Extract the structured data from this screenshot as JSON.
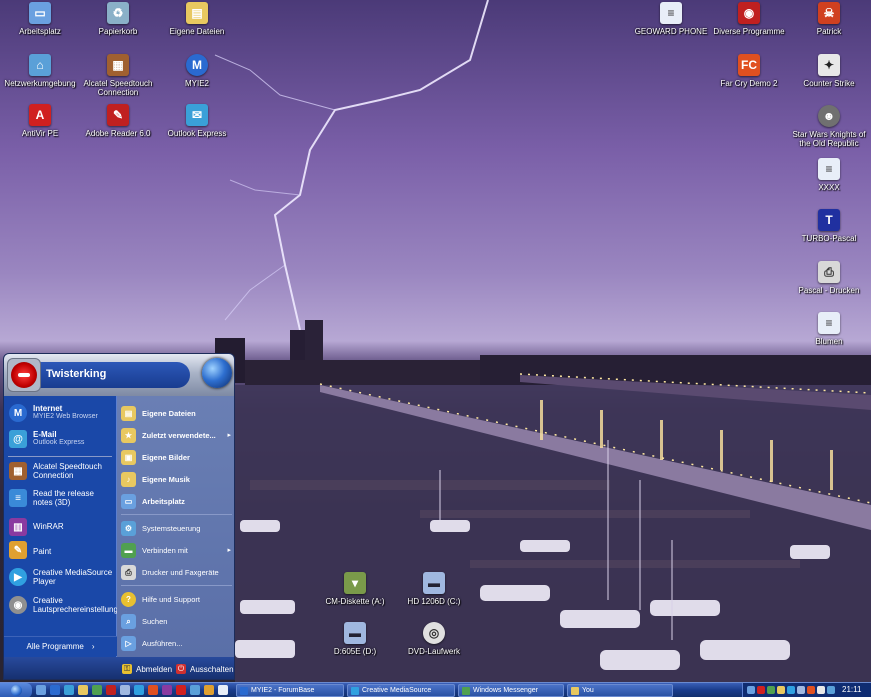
{
  "desktop": {
    "icons": [
      {
        "label": "Arbeitsplatz",
        "icon": "computer-icon",
        "color": "#6aa0e0"
      },
      {
        "label": "Papierkorb",
        "icon": "recycle-bin-icon",
        "color": "#8ab0c8"
      },
      {
        "label": "Eigene Dateien",
        "icon": "folder-icon",
        "color": "#e8c860"
      },
      {
        "label": "Netzwerkumgebung",
        "icon": "network-icon",
        "color": "#5aa0d8"
      },
      {
        "label": "Alcatel Speedtouch Connection",
        "icon": "modem-icon",
        "color": "#a06030"
      },
      {
        "label": "MYIE2",
        "icon": "browser-icon",
        "color": "#2a6ad0"
      },
      {
        "label": "AntiVir PE",
        "icon": "antivir-icon",
        "color": "#d02020"
      },
      {
        "label": "Adobe Reader 6.0",
        "icon": "pdf-icon",
        "color": "#c02020"
      },
      {
        "label": "Outlook Express",
        "icon": "mail-icon",
        "color": "#3aa0d8"
      },
      {
        "label": "GEOWARD PHONE",
        "icon": "document-icon",
        "color": "#e8eef8"
      },
      {
        "label": "Diverse Programme",
        "icon": "program-icon",
        "color": "#c02020"
      },
      {
        "label": "Patrick",
        "icon": "user-folder-icon",
        "color": "#d04020"
      },
      {
        "label": "Far Cry Demo 2",
        "icon": "farcry-icon",
        "color": "#e05020"
      },
      {
        "label": "Counter Strike",
        "icon": "counter-strike-icon",
        "color": "#e8e8e8"
      },
      {
        "label": "Star Wars Knights of the Old Republic",
        "icon": "game-icon",
        "color": "#707070"
      },
      {
        "label": "XXXX",
        "icon": "text-file-icon",
        "color": "#e8eef8"
      },
      {
        "label": "TURBO-Pascal",
        "icon": "turbo-pascal-icon",
        "color": "#2030a0"
      },
      {
        "label": "Pascal - Drucken",
        "icon": "printer-icon",
        "color": "#d8d8d8"
      },
      {
        "label": "Blumen",
        "icon": "text-file-icon",
        "color": "#e8eef8"
      },
      {
        "label": "CM-Diskette (A:)",
        "icon": "floppy-icon",
        "color": "#7a9a4a"
      },
      {
        "label": "HD 1206D (C:)",
        "icon": "hard-drive-icon",
        "color": "#a0b8e0"
      },
      {
        "label": "D:605E (D:)",
        "icon": "drive-icon",
        "color": "#a0b8e0"
      },
      {
        "label": "DVD-Laufwerk",
        "icon": "dvd-icon",
        "color": "#e0e0e0"
      }
    ]
  },
  "start_menu": {
    "username": "Twisterking",
    "left_items": [
      {
        "title": "Internet",
        "subtitle": "MYIE2 Web Browser",
        "icon": "browser-icon",
        "color": "#2a6ad0",
        "bold": true
      },
      {
        "title": "E-Mail",
        "subtitle": "Outlook Express",
        "icon": "mail-icon",
        "color": "#3aa0d8",
        "bold": true
      },
      {
        "title": "Alcatel Speedtouch Connection",
        "subtitle": "",
        "icon": "modem-icon",
        "color": "#a06030",
        "bold": false
      },
      {
        "title": "Read the release notes (3D)",
        "subtitle": "",
        "icon": "notes-icon",
        "color": "#3a8ad8",
        "bold": false
      },
      {
        "title": "WinRAR",
        "subtitle": "",
        "icon": "winrar-icon",
        "color": "#8a3aa0",
        "bold": false
      },
      {
        "title": "Paint",
        "subtitle": "",
        "icon": "paint-icon",
        "color": "#e0a030",
        "bold": false
      },
      {
        "title": "Creative MediaSource Player",
        "subtitle": "",
        "icon": "media-player-icon",
        "color": "#30a0e0",
        "bold": false
      },
      {
        "title": "Creative Lautsprechereinstellung",
        "subtitle": "",
        "icon": "speaker-icon",
        "color": "#909090",
        "bold": false
      }
    ],
    "all_programs": "Alle Programme",
    "right_items": [
      {
        "label": "Eigene Dateien",
        "icon": "folder-icon",
        "color": "#e8c860",
        "bold": true,
        "arrow": false
      },
      {
        "label": "Zuletzt verwendete...",
        "icon": "recent-icon",
        "color": "#e8c860",
        "bold": true,
        "arrow": true
      },
      {
        "label": "Eigene Bilder",
        "icon": "pictures-icon",
        "color": "#e8c860",
        "bold": true,
        "arrow": false
      },
      {
        "label": "Eigene Musik",
        "icon": "music-icon",
        "color": "#e8c860",
        "bold": true,
        "arrow": false
      },
      {
        "label": "Arbeitsplatz",
        "icon": "computer-icon",
        "color": "#6aa0e0",
        "bold": true,
        "arrow": false
      },
      {
        "label": "Systemsteuerung",
        "icon": "control-panel-icon",
        "color": "#5aa0d8",
        "bold": false,
        "arrow": false
      },
      {
        "label": "Verbinden mit",
        "icon": "connect-icon",
        "color": "#50a050",
        "bold": false,
        "arrow": true
      },
      {
        "label": "Drucker und Faxgeräte",
        "icon": "printer-icon",
        "color": "#d8d8d8",
        "bold": false,
        "arrow": false
      },
      {
        "label": "Hilfe und Support",
        "icon": "help-icon",
        "color": "#e8c030",
        "bold": false,
        "arrow": false
      },
      {
        "label": "Suchen",
        "icon": "search-icon",
        "color": "#6aa0e0",
        "bold": false,
        "arrow": false
      },
      {
        "label": "Ausführen...",
        "icon": "run-icon",
        "color": "#6aa0e0",
        "bold": false,
        "arrow": false
      }
    ],
    "logoff": "Abmelden",
    "shutdown": "Ausschalten"
  },
  "taskbar": {
    "tasks": [
      {
        "label": "MYIE2 - ForumBase",
        "color": "#2a6ad0"
      },
      {
        "label": "Creative MediaSource",
        "color": "#30a0e0"
      },
      {
        "label": "Windows Messenger",
        "color": "#50a050"
      },
      {
        "label": "You",
        "color": "#e8c860"
      }
    ],
    "clock": "21:11"
  },
  "colors": {
    "start_menu_blue": "#1a48a8",
    "start_menu_right": "#6a7fb4",
    "taskbar_blue": "#1a3c8c"
  }
}
